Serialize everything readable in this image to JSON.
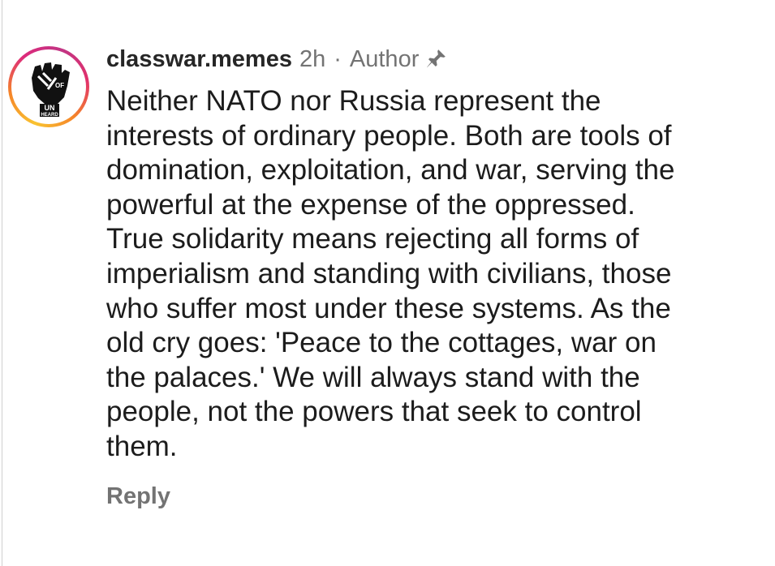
{
  "comment": {
    "username": "classwar.memes",
    "time": "2h",
    "separator": "·",
    "role": "Author",
    "pin_icon": "pin-icon",
    "avatar": {
      "description_icon": "raised-fist-logo",
      "lettering": [
        "OF",
        "UN",
        "HEARD"
      ]
    },
    "body_lines": [
      "Neither NATO nor Russia represent the",
      "interests of ordinary people. Both are tools of",
      "domination, exploitation, and war, serving the",
      "powerful at the expense of the oppressed.",
      "True solidarity means rejecting all forms of",
      "imperialism and standing with civilians, those",
      "who suffer most under these systems. As the",
      "old cry goes: 'Peace to the cottages, war on",
      "the palaces.' We will always stand with the",
      "people, not the powers that seek to control",
      "them."
    ],
    "reply_label": "Reply"
  },
  "colors": {
    "text_primary": "#1c1c1c",
    "text_secondary": "#737373",
    "ring_gradient": [
      "#f9c331",
      "#f58529",
      "#dd2a7b",
      "#c13584"
    ]
  }
}
